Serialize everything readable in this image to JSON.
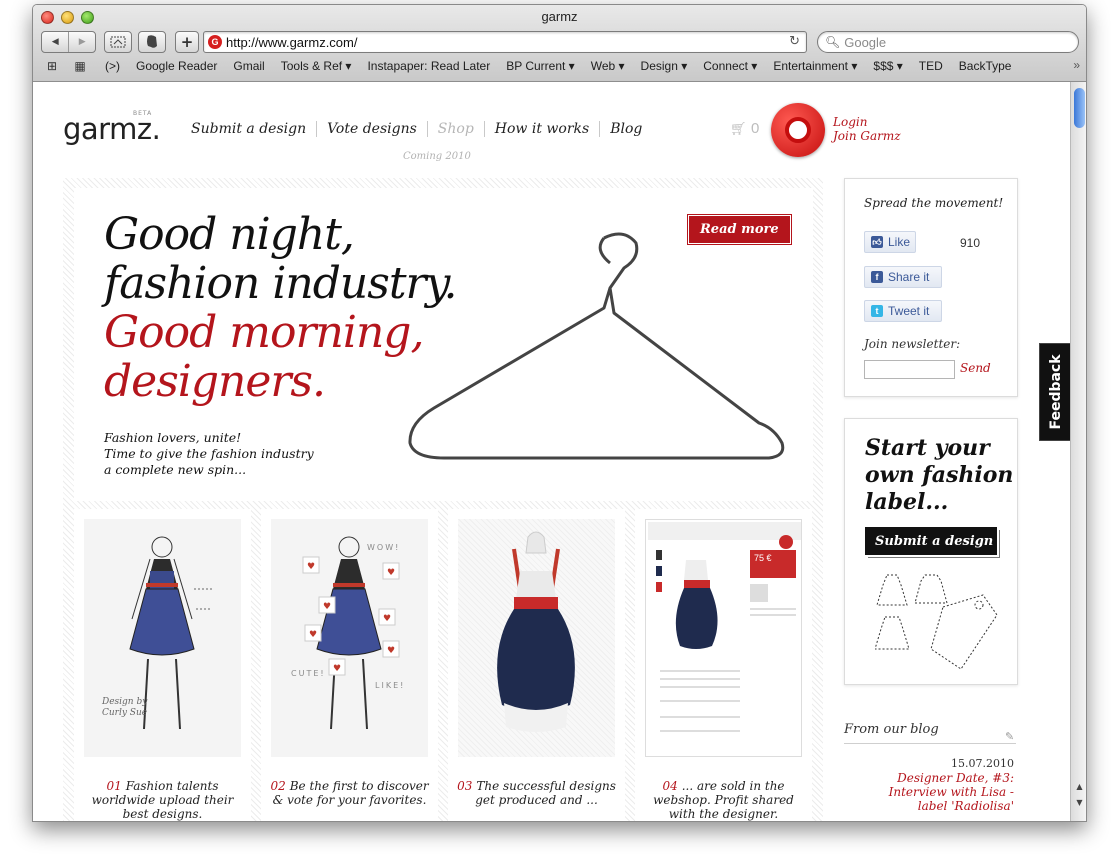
{
  "window": {
    "title": "garmz"
  },
  "toolbar": {
    "back": "◀",
    "forward": "▶",
    "plus": "+",
    "url": "http://www.garmz.com/",
    "reload": "↻",
    "search_placeholder": "Google"
  },
  "bookmarks": {
    "items": [
      "(>)",
      "Google Reader",
      "Gmail",
      "Tools & Ref ▾",
      "Instapaper: Read Later",
      "BP Current ▾",
      "Web ▾",
      "Design ▾",
      "Connect ▾",
      "Entertainment ▾",
      "$$$ ▾",
      "TED",
      "BackType"
    ],
    "more": "»"
  },
  "site": {
    "logo": "garmz.",
    "beta": "BETA",
    "nav": [
      "Submit a design",
      "Vote designs",
      "Shop",
      "How it works",
      "Blog"
    ],
    "coming": "Coming 2010",
    "cart_count": "0",
    "login": "Login",
    "join": "Join Garmz"
  },
  "hero": {
    "line1": "Good night,",
    "line2": "fashion industry.",
    "line3": "Good morning,",
    "line4": "designers.",
    "sub1": "Fashion lovers, unite!",
    "sub2": "Time to give the fashion industry",
    "sub3": "a complete new spin...",
    "read_more": "Read more"
  },
  "steps": [
    {
      "num": "01",
      "text": "Fashion talents worldwide upload their best designs.",
      "sketch_credit_1": "Design by",
      "sketch_credit_2": "Curly Sue"
    },
    {
      "num": "02",
      "text": "Be the first to discover & vote for your favorites.",
      "vote1": "WOW!",
      "vote2": "CUTE!",
      "vote3": "LIKE!"
    },
    {
      "num": "03",
      "text": "The successful designs get produced and ..."
    },
    {
      "num": "04",
      "text": "... are sold in the webshop. Profit shared with the designer.",
      "price": "75 €"
    }
  ],
  "sidebar": {
    "spread_title": "Spread the movement!",
    "like": "Like",
    "like_count": "910",
    "share": "Share it",
    "tweet": "Tweet it",
    "newsletter_label": "Join newsletter:",
    "send": "Send",
    "label_title_1": "Start your",
    "label_title_2": "own fashion",
    "label_title_3": "label...",
    "submit": "Submit a design",
    "blog_head": "From our blog",
    "blog_date": "15.07.2010",
    "blog_post": "Designer Date, #3: Interview with Lisa - label 'Radiolisa'"
  },
  "feedback": "Feedback",
  "colors": {
    "brand_red": "#b4151c",
    "text": "#111111",
    "mac_blue": "#3b78d8"
  }
}
